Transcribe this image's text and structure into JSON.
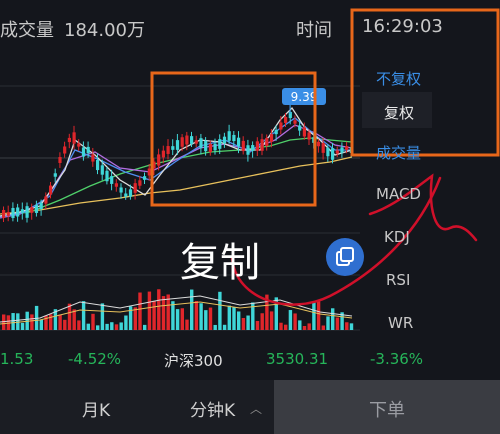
{
  "header": {
    "volume_label": "成交量",
    "volume_value": "184.00万",
    "time_label": "时间",
    "time_value": "16:29:03"
  },
  "price_badge": "9.39",
  "indicator_menu": {
    "items": [
      "不复权",
      "复权",
      "成交量",
      "MACD",
      "KDJ",
      "RSI",
      "WR"
    ],
    "active_color": "#3a8ee6"
  },
  "overlay": {
    "copy_text": "复制",
    "copy_icon": "copy-icon"
  },
  "index_row": {
    "left_value": "1.53",
    "left_change": "-4.52%",
    "index_name": "沪深300",
    "index_value": "3530.31",
    "index_change": "-3.36%"
  },
  "footer": {
    "tab_month": "月K",
    "tab_minute": "分钟K",
    "sell_label": "下单"
  },
  "colors": {
    "up": "#e0262b",
    "down": "#3fd6d8",
    "green_text": "#26b55a",
    "annotation_orange": "#e8671a",
    "annotation_red": "#d0102a",
    "accent_blue": "#3a8ee6"
  }
}
